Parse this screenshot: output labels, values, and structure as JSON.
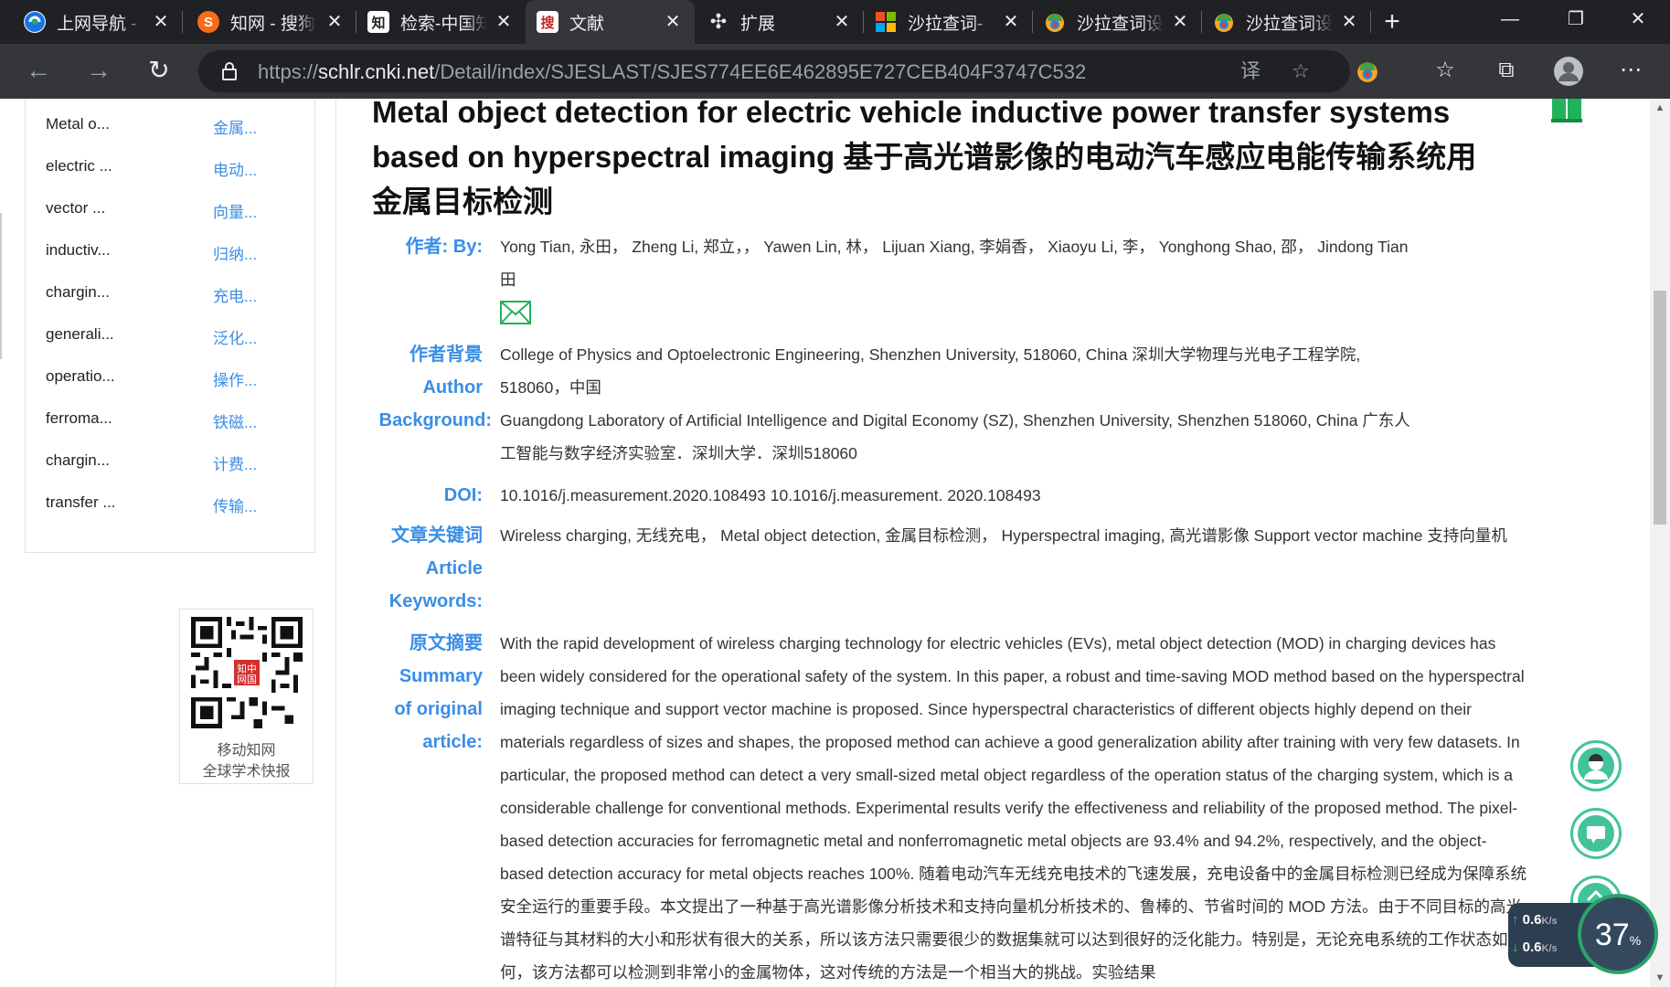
{
  "browser": {
    "tabs": [
      {
        "title": "上网导航 -",
        "icon": "browser-logo-icon",
        "active": false
      },
      {
        "title": "知网 - 搜狗",
        "icon": "sogou-icon",
        "active": false
      },
      {
        "title": "检索-中国知",
        "icon": "cnki-icon",
        "active": false
      },
      {
        "title": "文献",
        "icon": "sogou-search-icon",
        "active": true
      },
      {
        "title": "扩展",
        "icon": "puzzle-icon",
        "active": false
      },
      {
        "title": "沙拉查词-",
        "icon": "windows-icon",
        "active": false
      },
      {
        "title": "沙拉查词设",
        "icon": "saladict-icon",
        "active": false
      },
      {
        "title": "沙拉查词设",
        "icon": "saladict-icon",
        "active": false
      }
    ],
    "url_scheme": "https://",
    "url_host": "schlr.cnki.net",
    "url_path": "/Detail/index/SJESLAST/SJES774EE6E462895E727CEB404F3747C532",
    "translate_glyph": "译"
  },
  "sidebar_keywords": [
    {
      "en": "Metal o...",
      "cn": "金属..."
    },
    {
      "en": "electric ...",
      "cn": "电动..."
    },
    {
      "en": "vector ...",
      "cn": "向量..."
    },
    {
      "en": "inductiv...",
      "cn": "归纳..."
    },
    {
      "en": "chargin...",
      "cn": "充电..."
    },
    {
      "en": "generali...",
      "cn": "泛化..."
    },
    {
      "en": "operatio...",
      "cn": "操作..."
    },
    {
      "en": "ferroma...",
      "cn": "铁磁..."
    },
    {
      "en": "chargin...",
      "cn": "计费..."
    },
    {
      "en": "transfer ...",
      "cn": "传输..."
    }
  ],
  "qr": {
    "caption1": "移动知网",
    "caption2": "全球学术快报",
    "stamp": "知中\n网国"
  },
  "article": {
    "title": "Metal object detection for electric vehicle inductive power transfer systems based on hyperspectral imaging 基于高光谱影像的电动汽车感应电能传输系统用金属目标检测",
    "authors_label": "作者: By:",
    "authors": "Yong Tian, 永田， Zheng Li, 郑立，， Yawen Lin, 林， Lijuan Xiang, 李娟香， Xiaoyu Li, 李， Yonghong Shao, 邵， Jindong Tian 田",
    "background_label_cn": "作者背景",
    "background_label_en1": "Author",
    "background_label_en2": "Background:",
    "affiliation1": "College of Physics and Optoelectronic Engineering, Shenzhen University, 518060, China 深圳大学物理与光电子工程学院, 518060，中国",
    "affiliation2": "Guangdong Laboratory of Artificial Intelligence and Digital Economy (SZ), Shenzhen University, Shenzhen 518060, China 广东人工智能与数字经济实验室．深圳大学．深圳518060",
    "doi_label": "DOI:",
    "doi": "10.1016/j.measurement.2020.108493 10.1016/j.measurement. 2020.108493",
    "keywords_label_cn": "文章关键词",
    "keywords_label_en1": "Article",
    "keywords_label_en2": "Keywords:",
    "keywords": "Wireless charging, 无线充电， Metal object detection, 金属目标检测， Hyperspectral imaging, 高光谱影像 Support vector machine 支持向量机",
    "summary_label_cn": "原文摘要",
    "summary_label_en1": "Summary",
    "summary_label_en2": "of original",
    "summary_label_en3": "article:",
    "abstract": "With the rapid development of wireless charging technology for electric vehicles (EVs), metal object detection (MOD) in charging devices has been widely considered for the operational safety of the system. In this paper, a robust and time-saving MOD method based on the hyperspectral imaging technique and support vector machine is proposed. Since hyperspectral characteristics of different objects highly depend on their materials regardless of sizes and shapes, the proposed method can achieve a good generalization ability after training with very few datasets. In particular, the proposed method can detect a very small-sized metal object regardless of the operation status of the charging system, which is a considerable challenge for conventional methods. Experimental results verify the effectiveness and reliability of the proposed method. The pixel-based detection accuracies for ferromagnetic metal and nonferromagnetic metal objects are 93.4% and 94.2%, respectively, and the object-based detection accuracy for metal objects reaches 100%. 随着电动汽车无线充电技术的飞速发展，充电设备中的金属目标检测已经成为保障系统安全运行的重要手段。本文提出了一种基于高光谱影像分析技术和支持向量机分析技术的、鲁棒的、节省时间的 MOD 方法。由于不同目标的高光谱特征与其材料的大小和形状有很大的关系，所以该方法只需要很少的数据集就可以达到很好的泛化能力。特别是，无论充电系统的工作状态如何，该方法都可以检测到非常小的金属物体，这对传统的方法是一个相当大的挑战。实验结果"
  },
  "net_widget": {
    "up": "0.6",
    "down": "0.6",
    "unit": "K/s",
    "percent": "37",
    "percent_sign": "%"
  }
}
